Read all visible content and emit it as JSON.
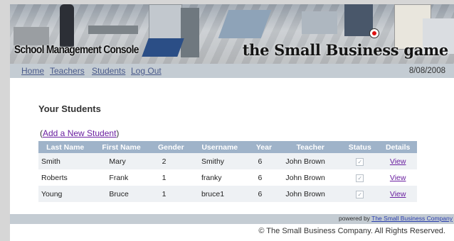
{
  "header": {
    "title_left": "School Management Console",
    "title_right": "the Small Business game"
  },
  "nav": {
    "items": [
      "Home",
      "Teachers",
      "Students",
      "Log Out"
    ],
    "date": "8/08/2008"
  },
  "main": {
    "heading": "Your Students",
    "add_open": "(",
    "add_link": "Add a New Student",
    "add_close": ")",
    "columns": [
      "Last Name",
      "First Name",
      "Gender",
      "Username",
      "Year",
      "Teacher",
      "Status",
      "Details"
    ],
    "rows": [
      {
        "last": "Smith",
        "first": "Mary",
        "gender": "2",
        "username": "Smithy",
        "year": "6",
        "teacher": "John Brown",
        "status_checked": true,
        "details": "View"
      },
      {
        "last": "Roberts",
        "first": "Frank",
        "gender": "1",
        "username": "franky",
        "year": "6",
        "teacher": "John Brown",
        "status_checked": true,
        "details": "View"
      },
      {
        "last": "Young",
        "first": "Bruce",
        "gender": "1",
        "username": "bruce1",
        "year": "6",
        "teacher": "John Brown",
        "status_checked": true,
        "details": "View"
      }
    ]
  },
  "footer": {
    "powered_prefix": "powered by ",
    "powered_link": "The Small Business Company",
    "copyright": "© The Small Business Company. All Rights Reserved."
  },
  "colors": {
    "nav_bg": "#c4ccd3",
    "table_header": "#9fb3c9",
    "link": "#6a1fa0"
  }
}
